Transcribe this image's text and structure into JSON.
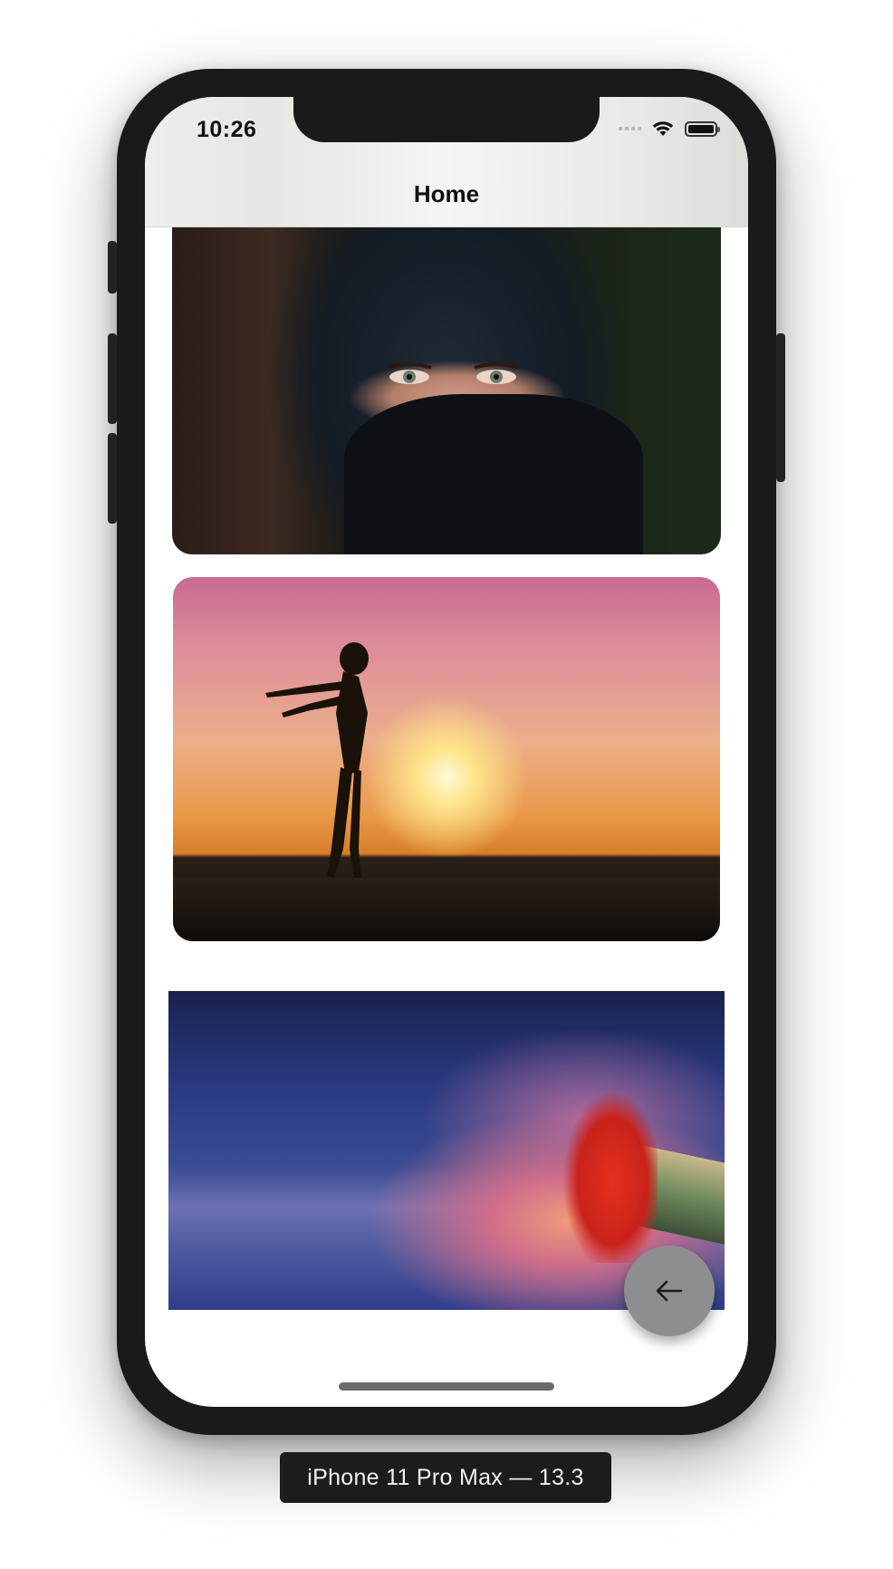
{
  "status_bar": {
    "time": "10:26",
    "icons": [
      "cellular-signal-icon",
      "wifi-icon",
      "battery-icon"
    ]
  },
  "nav": {
    "title": "Home"
  },
  "content": {
    "images": [
      {
        "name": "hijab-portrait-image",
        "subject": "woman in black hijab"
      },
      {
        "name": "sunset-silhouette-image",
        "subject": "silhouette at sunset"
      },
      {
        "name": "ocean-boat-image",
        "subject": "woman in red dress on boat"
      }
    ]
  },
  "fab": {
    "icon": "arrow-left-icon",
    "color": "#8e8e92"
  },
  "device": {
    "label": "iPhone 11 Pro Max — 13.3"
  },
  "colors": {
    "frame": "#1a1a1a",
    "screen_bg": "#ffffff",
    "nav_bg": "#efefec"
  }
}
